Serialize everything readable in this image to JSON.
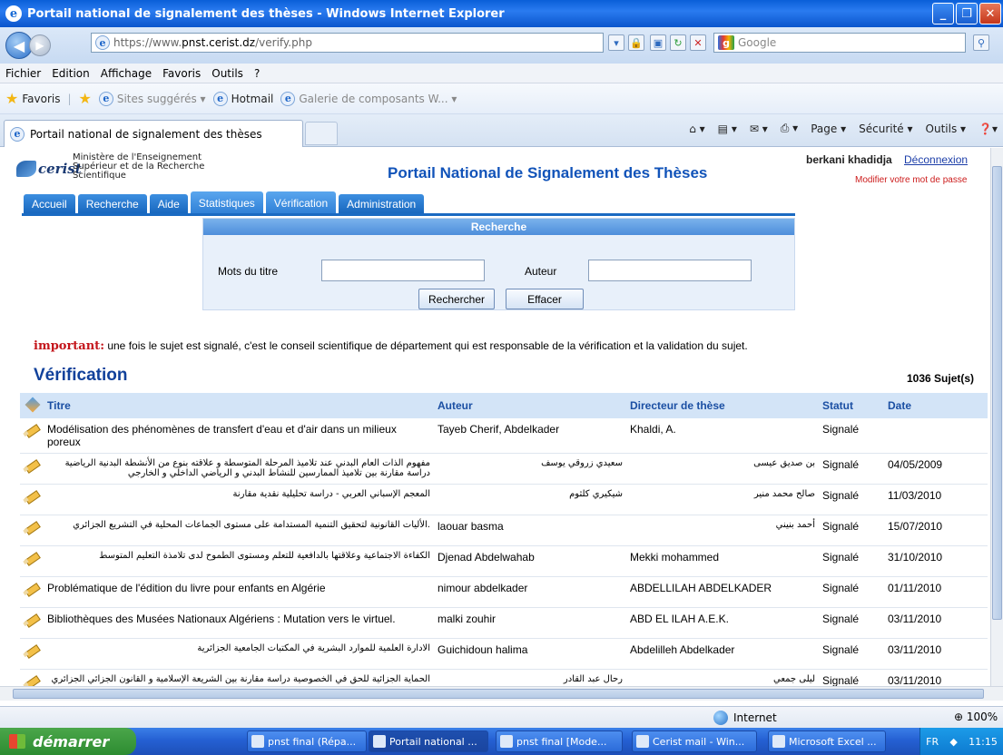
{
  "window": {
    "title": "Portail national de signalement des thèses - Windows Internet Explorer",
    "controls": {
      "minimize": "_",
      "maximize": "❐",
      "close": "✕"
    }
  },
  "address": {
    "prefix": "https://www.",
    "domain": "pnst.cerist.dz",
    "path": "/verify.php",
    "search_placeholder": "Google"
  },
  "menu": [
    "Fichier",
    "Edition",
    "Affichage",
    "Favoris",
    "Outils",
    "?"
  ],
  "favorites": {
    "label": "Favoris",
    "items": [
      {
        "label": "Sites suggérés ▾",
        "dim": true
      },
      {
        "label": "Hotmail",
        "dim": false
      },
      {
        "label": "Galerie de composants W... ▾",
        "dim": true
      }
    ]
  },
  "tab": {
    "title": "Portail national de signalement des thèses"
  },
  "commandbar": [
    "Page ▾",
    "Sécurité ▾",
    "Outils ▾"
  ],
  "site": {
    "logo": "cerist",
    "ministry": [
      "Ministère de l'Enseignement",
      "Supérieur et de la Recherche",
      "Scientifique"
    ],
    "title": "Portail National de Signalement des Thèses",
    "user": "berkani khadidja",
    "logout": "Déconnexion",
    "change_password": "Modifier votre mot de passe"
  },
  "nav": [
    {
      "label": "Accueil",
      "active": false
    },
    {
      "label": "Recherche",
      "active": false
    },
    {
      "label": "Aide",
      "active": false
    },
    {
      "label": "Statistiques",
      "active": true
    },
    {
      "label": "Vérification",
      "active": true
    },
    {
      "label": "Administration",
      "active": false
    }
  ],
  "search": {
    "header": "Recherche",
    "title_label": "Mots du titre",
    "title_value": "",
    "author_label": "Auteur",
    "author_value": "",
    "submit": "Rechercher",
    "reset": "Effacer"
  },
  "notice": {
    "prefix": "important:",
    "text": " une fois le sujet est signalé, c'est le conseil scientifique de département qui est responsable de la vérification et la validation du sujet."
  },
  "verification": {
    "title": "Vérification",
    "count": "1036 Sujet(s)"
  },
  "table": {
    "headers": [
      "Titre",
      "Auteur",
      "Directeur de thèse",
      "Statut",
      "Date"
    ],
    "rows": [
      {
        "title": "Modélisation des phénomènes de transfert d'eau et d'air dans un milieux poreux",
        "author": "Tayeb Cherif, Abdelkader",
        "director": "Khaldi, A.",
        "status": "Signalé",
        "date": "",
        "rtl": false
      },
      {
        "title": "مفهوم الذات العام البدني عند تلاميذ المرحلة المتوسطة و علاقته بنوع من الأنشطة البدنية الرياضية دراسة مقارنة بين تلاميذ الممارسين للنشاط البدني و الرياضي الداخلي و الخارجي",
        "author": "سعيدي زروقي يوسف",
        "director": "بن صديق عيسى",
        "status": "Signalé",
        "date": "04/05/2009",
        "rtl": true
      },
      {
        "title": "المعجم الإسباني العربي - دراسة تحليلية نقدية مقارنة",
        "author": "شيكيري كلثوم",
        "director": "صالح محمد منير",
        "status": "Signalé",
        "date": "11/03/2010",
        "rtl": true
      },
      {
        "title": ".الأليات القانونية لتحقيق التنمية المستدامة على مستوى الجماعات المحلية في التشريع الجزائري",
        "author": "laouar basma",
        "director": "أحمد بنيني",
        "status": "Signalé",
        "date": "15/07/2010",
        "rtl": true
      },
      {
        "title": "الكفاءة الاجتماعية وعلاقتها بالدافعية للتعلم ومستوى الطموح لدى تلامذة التعليم المتوسط",
        "author": "Djenad Abdelwahab",
        "director": "Mekki mohammed",
        "status": "Signalé",
        "date": "31/10/2010",
        "rtl": true
      },
      {
        "title": "Problématique de l'édition du livre pour enfants en Algérie",
        "author": "nimour abdelkader",
        "director": "ABDELLILAH ABDELKADER",
        "status": "Signalé",
        "date": "01/11/2010",
        "rtl": false
      },
      {
        "title": "Bibliothèques des Musées Nationaux Algériens : Mutation vers le virtuel.",
        "author": "malki zouhir",
        "director": "ABD EL ILAH A.E.K.",
        "status": "Signalé",
        "date": "03/11/2010",
        "rtl": false
      },
      {
        "title": "الادارة العلمية للموارد البشرية في المكتبات الجامعية الجزائرية",
        "author": "Guichidoun halima",
        "director": "Abdelilleh Abdelkader",
        "status": "Signalé",
        "date": "03/11/2010",
        "rtl": true
      },
      {
        "title": "الحماية الجزائية للحق في الخصوصية دراسة مقارنة بين الشريعة الإسلامية و القانون الجزائي الجزائري",
        "author": "رحال عبد القادر",
        "director": "ليلى جمعي",
        "status": "Signalé",
        "date": "03/11/2010",
        "rtl": true
      }
    ]
  },
  "status": {
    "zone": "Internet",
    "zoom": "100%"
  },
  "taskbar": {
    "start": "démarrer",
    "items": [
      {
        "label": "pnst final (Répa..."
      },
      {
        "label": "Portail national ..."
      },
      {
        "label": "pnst final [Mode..."
      },
      {
        "label": "Cerist mail - Win..."
      },
      {
        "label": "Microsoft Excel ..."
      }
    ],
    "lang": "FR",
    "clock": "11:15"
  }
}
